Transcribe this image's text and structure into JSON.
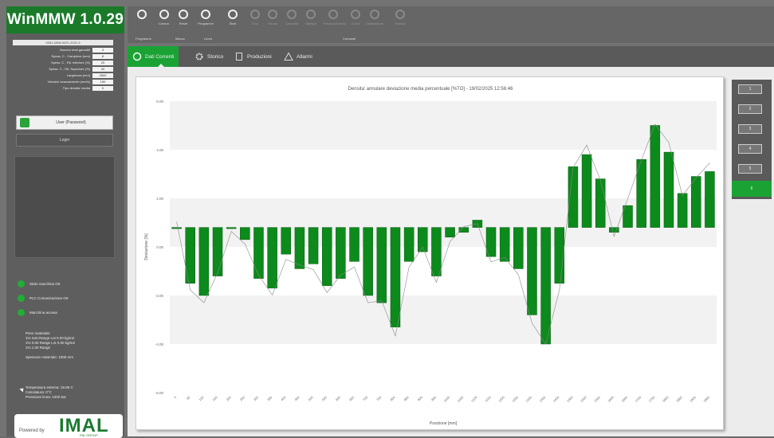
{
  "app": {
    "title": "WinMMW 1.0.29"
  },
  "sidebar": {
    "machine_id": "0051-0008-0021-2021-5",
    "params": [
      {
        "label": "Numero testi garantiti",
        "value": "3"
      },
      {
        "label": "Spess. C - Campione (mm)",
        "value": "8"
      },
      {
        "label": "Spess. C - Rit. Inferiore (%)",
        "value": "20"
      },
      {
        "label": "Spess. C - Rit. Superiore (%)",
        "value": "20"
      },
      {
        "label": "Larghezza (mm)",
        "value": "2600"
      },
      {
        "label": "Velocita' avanzamento (mm/s)",
        "value": "150"
      },
      {
        "label": "Tipo densita' media",
        "value": "0"
      }
    ],
    "user_label": "User (Password)",
    "login_label": "Login",
    "status": [
      {
        "label": "Stato macchina OK"
      },
      {
        "label": "PLC Comunicazione OK"
      },
      {
        "label": "Macchina accesa"
      }
    ],
    "info_lines": [
      "Peso materiale:",
      "1% Sott Range Lot 0.00 kg/m2",
      "1% 0.00 Range Lot 0.00 kg/m2",
      "1% 1.00 Range"
    ],
    "info_thickness": "Spessore materiale: 1000 mm",
    "info_bottom": [
      "Temperatura esterna: 18.85 C",
      "Calcolatura: 0°C",
      "Pressione linea: 1000 bar"
    ],
    "logo": {
      "powered": "Powered by",
      "name": "IMAL",
      "sub": "PAL GROUP"
    }
  },
  "toolbar": {
    "buttons": [
      {
        "label": "",
        "icon": "x-icon",
        "enabled": true
      },
      {
        "label": "Comun.",
        "icon": "gear-icon",
        "enabled": true
      },
      {
        "label": "Reset",
        "icon": "reset-icon",
        "enabled": true
      },
      {
        "label": "Programmi",
        "icon": "home-icon",
        "enabled": true
      },
      {
        "label": "Start",
        "icon": "play-icon",
        "enabled": true
      },
      {
        "label": "Stop",
        "icon": "stop-icon",
        "enabled": false
      },
      {
        "label": "Pausa",
        "icon": "pause-icon",
        "enabled": false
      },
      {
        "label": "Cancella",
        "icon": "clipboard-icon",
        "enabled": false
      },
      {
        "label": "Stampa",
        "icon": "star-icon",
        "enabled": false
      },
      {
        "label": "Posizionamento",
        "icon": "target-icon",
        "enabled": false
      },
      {
        "label": "Corsa",
        "icon": "circle-icon",
        "enabled": false
      },
      {
        "label": "Calibrazione",
        "icon": "calibrate-icon",
        "enabled": false
      },
      {
        "label": "Sensori",
        "icon": "sensor-icon",
        "enabled": false
      }
    ],
    "groups": [
      "Programmi",
      "Misure",
      "Linea",
      "Comandi"
    ]
  },
  "tabs": [
    {
      "label": "Dati Correnti",
      "icon": "refresh-icon",
      "active": true
    },
    {
      "label": "Storico",
      "icon": "gear-icon",
      "active": false
    },
    {
      "label": "Produzioni",
      "icon": "document-icon",
      "active": false
    },
    {
      "label": "Allarmi",
      "icon": "warning-icon",
      "active": false
    }
  ],
  "series_selector": [
    "1",
    "2",
    "3",
    "4",
    "5",
    "6"
  ],
  "chart_data": {
    "type": "bar",
    "title": "Densita' annulare deviazione media percentuale [%TO] - 19/02/2025 12:56:46",
    "xlabel": "Posizione [mm]",
    "ylabel": "Deviazione [%]",
    "ylim": [
      -6,
      6
    ],
    "yticks": [
      "6.00",
      "4.00",
      "2.00",
      "0.00",
      "-2.00",
      "-4.00",
      "-6.00"
    ],
    "categories": [
      "0",
      "50",
      "100",
      "150",
      "200",
      "250",
      "300",
      "350",
      "400",
      "450",
      "500",
      "550",
      "600",
      "650",
      "700",
      "750",
      "800",
      "850",
      "900",
      "950",
      "1000",
      "1050",
      "1100",
      "1150",
      "1200",
      "1250",
      "1300",
      "1350",
      "1400",
      "1450",
      "1500",
      "1550",
      "1600",
      "1650",
      "1700",
      "1750",
      "1800",
      "1850",
      "1900",
      "1950",
      "2000",
      "2050",
      "2100",
      "2150",
      "2200"
    ],
    "values": [
      0.8,
      -1.5,
      -2.0,
      -1.2,
      0.8,
      0.3,
      -1.3,
      -1.7,
      -0.3,
      -0.9,
      -0.7,
      -1.6,
      -1.3,
      -0.6,
      -2.0,
      -2.3,
      -3.3,
      -0.6,
      -0.2,
      -1.2,
      0.4,
      0.6,
      1.1,
      -0.4,
      -0.6,
      -0.9,
      -2.8,
      -4.0,
      -1.5,
      3.3,
      3.8,
      2.8,
      0.6,
      1.7,
      3.6,
      5.0,
      3.9,
      2.2,
      2.9,
      3.1,
      0,
      0,
      0,
      0,
      0
    ],
    "bar_count": 40,
    "colors": {
      "bar": "#0c8a1c",
      "bar_border": "#0a5e14",
      "line": "#888888"
    },
    "grid": true
  }
}
